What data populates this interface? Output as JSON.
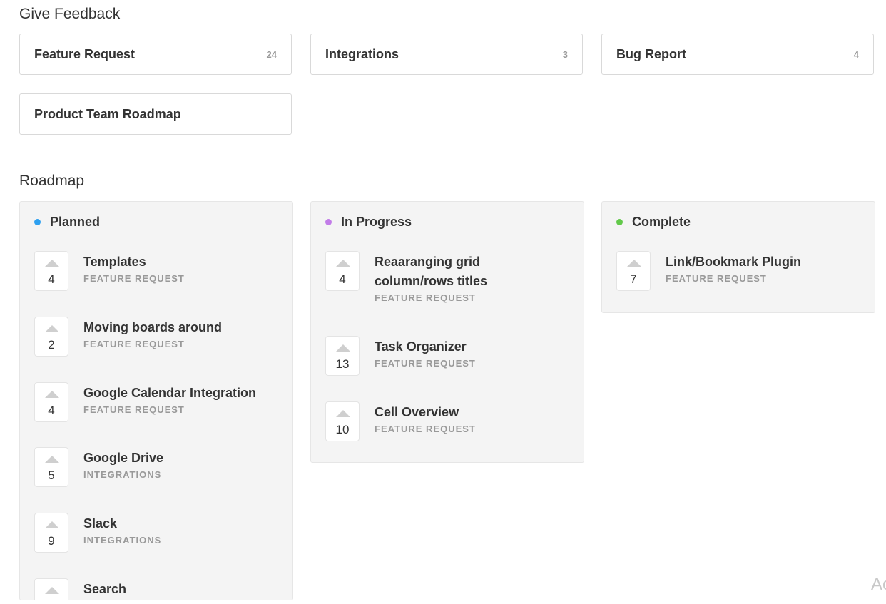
{
  "feedback": {
    "title": "Give Feedback",
    "boards": [
      {
        "name": "Feature Request",
        "count": "24"
      },
      {
        "name": "Integrations",
        "count": "3"
      },
      {
        "name": "Bug Report",
        "count": "4"
      },
      {
        "name": "Product Team Roadmap",
        "count": ""
      }
    ]
  },
  "roadmap": {
    "title": "Roadmap",
    "columns": [
      {
        "title": "Planned",
        "dot_color": "#2ea0f0",
        "posts": [
          {
            "title": "Templates",
            "board": "FEATURE REQUEST",
            "votes": "4"
          },
          {
            "title": "Moving boards around",
            "board": "FEATURE REQUEST",
            "votes": "2"
          },
          {
            "title": "Google Calendar Integration",
            "board": "FEATURE REQUEST",
            "votes": "4"
          },
          {
            "title": "Google Drive",
            "board": "INTEGRATIONS",
            "votes": "5"
          },
          {
            "title": "Slack",
            "board": "INTEGRATIONS",
            "votes": "9"
          },
          {
            "title": "Search",
            "board": "",
            "votes": ""
          }
        ]
      },
      {
        "title": "In Progress",
        "dot_color": "#c27ce8",
        "posts": [
          {
            "title": "Reaaranging grid column/rows titles",
            "board": "FEATURE REQUEST",
            "votes": "4"
          },
          {
            "title": "Task Organizer",
            "board": "FEATURE REQUEST",
            "votes": "13"
          },
          {
            "title": "Cell Overview",
            "board": "FEATURE REQUEST",
            "votes": "10"
          }
        ]
      },
      {
        "title": "Complete",
        "dot_color": "#62c94a",
        "posts": [
          {
            "title": "Link/Bookmark Plugin",
            "board": "FEATURE REQUEST",
            "votes": "7"
          }
        ]
      }
    ]
  },
  "corner_text": "Ac"
}
